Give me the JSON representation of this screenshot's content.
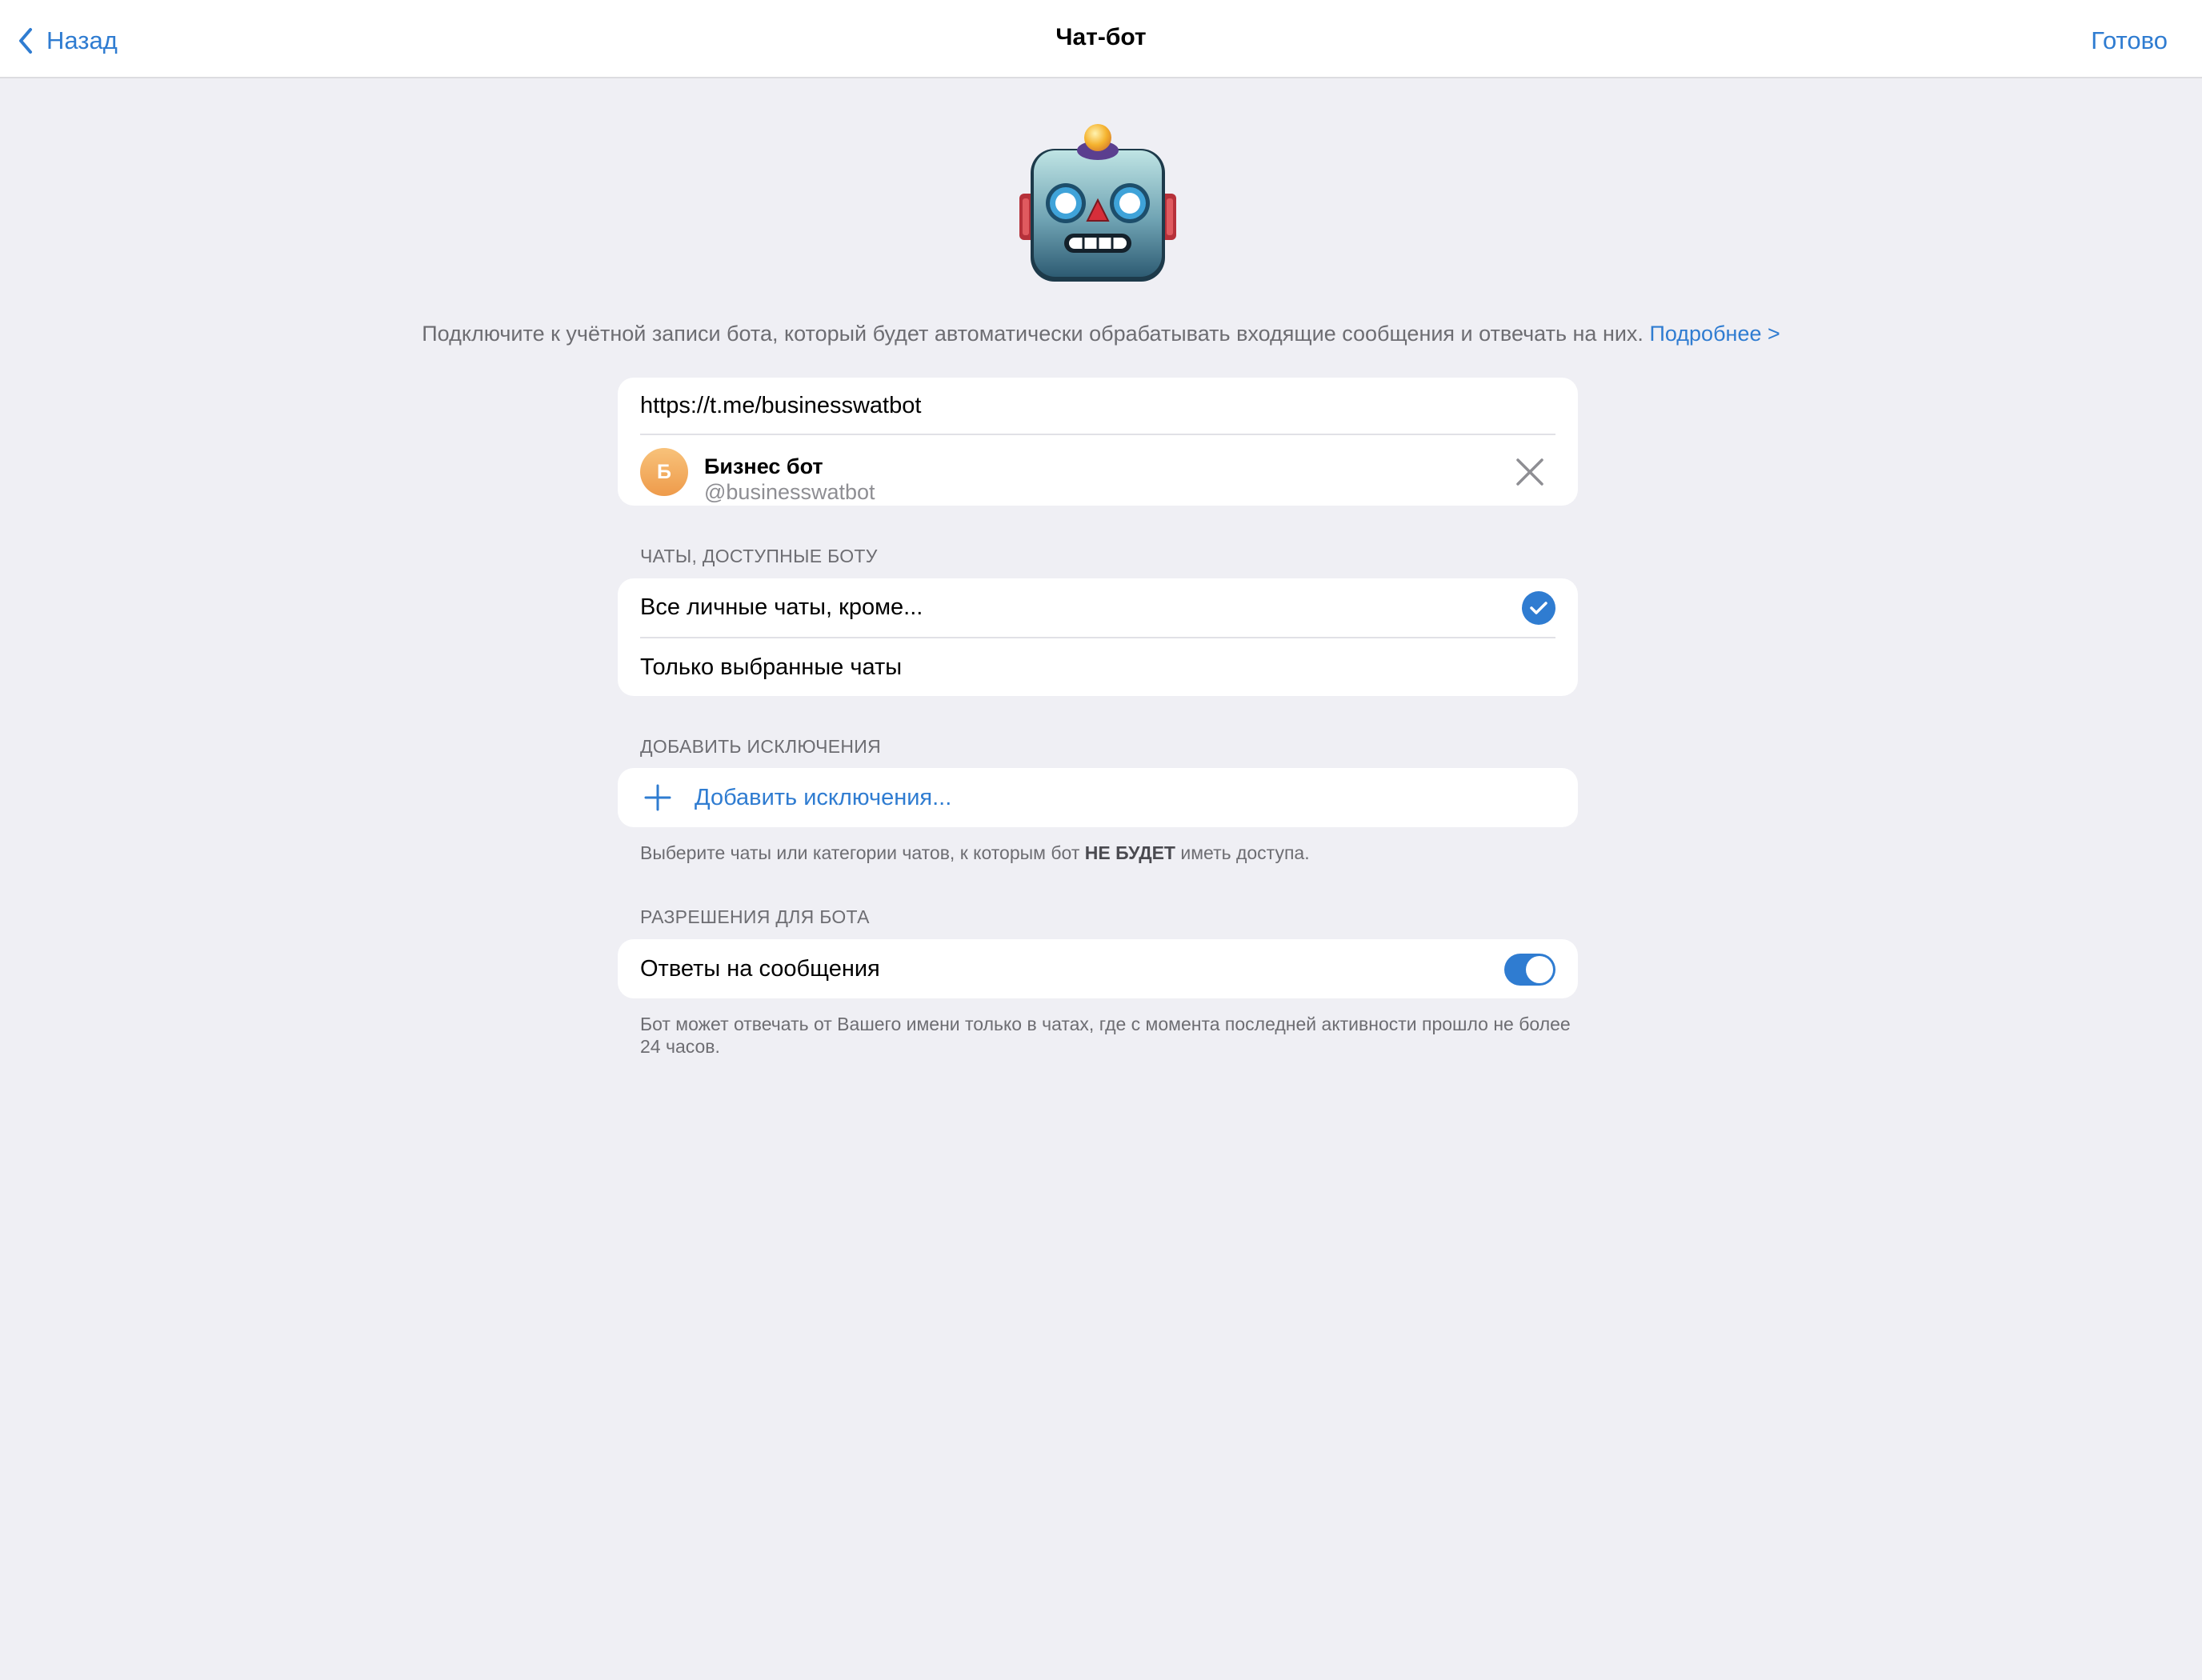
{
  "navbar": {
    "back_label": "Назад",
    "title": "Чат-бот",
    "done_label": "Готово"
  },
  "intro": {
    "text": "Подключите к учётной записи бота, который будет автоматически обрабатывать входящие сообщения и отвечать на них.",
    "link": "Подробнее >"
  },
  "bot_card": {
    "url": "https://t.me/businesswatbot",
    "avatar_letter": "Б",
    "avatar_colors": [
      "#F8C27A",
      "#EE9B4B"
    ],
    "name": "Бизнес бот",
    "username": "@businesswatbot"
  },
  "chats_section": {
    "header": "ЧАТЫ, ДОСТУПНЫЕ БОТУ",
    "options": [
      {
        "label": "Все личные чаты, кроме...",
        "selected": true
      },
      {
        "label": "Только выбранные чаты",
        "selected": false
      }
    ]
  },
  "exclusions_section": {
    "header": "ДОБАВИТЬ ИСКЛЮЧЕНИЯ",
    "add_label": "Добавить исключения...",
    "footer_before": "Выберите чаты или категории чатов, к которым бот",
    "footer_bold": "НЕ БУДЕТ",
    "footer_after": "иметь доступа."
  },
  "permissions_section": {
    "header": "РАЗРЕШЕНИЯ ДЛЯ БОТА",
    "reply_label": "Ответы на сообщения",
    "reply_enabled": true,
    "footer": "Бот может отвечать от Вашего имени только в чатах, где с момента последней активности прошло не более 24 часов."
  },
  "colors": {
    "accent": "#2F7CD1",
    "background": "#EFEFF4",
    "card": "#FFFFFF",
    "secondary_text": "#6D6D72"
  },
  "icons": {
    "back": "chevron-left-icon",
    "robot": "robot-face-icon",
    "close": "close-icon",
    "check": "checkmark-icon",
    "add": "plus-icon"
  }
}
